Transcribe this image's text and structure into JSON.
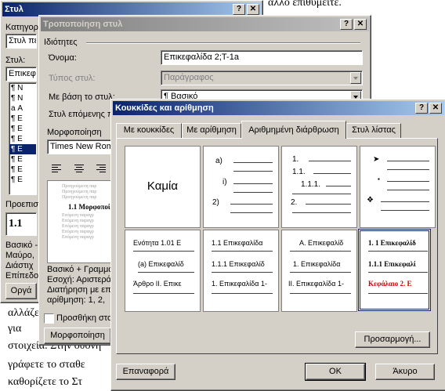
{
  "document": {
    "top_right_text": "άλλο επιθυμείτε.",
    "lines": [
      "αλλάζετε",
      "για",
      "στοιχεία. Στην οθόνη",
      "γράφετε το σταθε",
      "καθορίζετε το Στ"
    ]
  },
  "style_dialog": {
    "title": "Στυλ",
    "help": "?",
    "close": "✕",
    "category_label": "Κατηγορ",
    "category_value": "Στυλ πε",
    "styles_label": "Στυλ:",
    "styles_value": "Επικεφ",
    "style_items": [
      "¶ Ν",
      "¶ Ν",
      "a Α",
      "¶ Ε",
      "¶ Ε",
      "¶ Ε",
      "¶ Ε",
      "¶ Ε",
      "¶ Ε",
      "¶ Ε"
    ],
    "preview_label": "Προεπισ",
    "preview_sample": "1.1",
    "description_lines": [
      "Βασικό -",
      "Μαύρο,",
      "Διάστιχ",
      "Επίπεδο"
    ],
    "organizer_button": "Οργά"
  },
  "modify_dialog": {
    "title": "Τροποποίηση στυλ",
    "help": "?",
    "close": "✕",
    "group_label": "Ιδιότητες",
    "name_label": "Όνομα:",
    "name_value": "Επικεφαλίδα 2;T-1a",
    "style_type_label": "Τύπος στυλ:",
    "style_type_value": "Παράγραφος",
    "based_on_label": "Με βάση το στυλ:",
    "based_on_value": "¶ Βασικό",
    "next_style_label": "Στυλ επόμενης π",
    "formatting_label": "Μορφοποίηση",
    "font_value": "Times New Rom",
    "preview_heading": "1.1 Μορφοποί",
    "preview_dim": "Προηγούμενη παρ",
    "preview_next": "Επόμενη παραγρ",
    "description": [
      "Βασικό + Γραμμα",
      "Εσοχή: Αριστερά",
      "Διατήρηση με επο",
      "αρίθμηση: 1, 2,"
    ],
    "add_template_label": "Προσθήκη στο",
    "format_button": "Μορφοποίηση"
  },
  "bullets_dialog": {
    "title": "Κουκκίδες και αρίθμηση",
    "help": "?",
    "close": "✕",
    "tabs": [
      "Με κουκκίδες",
      "Με αρίθμηση",
      "Αριθμημένη διάρθρωση",
      "Στυλ λίστας"
    ],
    "selected_tab": 2,
    "none_label": "Καμία",
    "gallery_row1": {
      "c2": [
        "a)",
        "i)",
        "2)"
      ],
      "c3": [
        "1.",
        "1.1.",
        "1.1.1.",
        "2."
      ],
      "c4": [
        "➤",
        "▪",
        "❖"
      ]
    },
    "gallery_row2": {
      "c1": [
        "Ενότητα 1.01 Ε",
        "(a) Επικεφαλίδ",
        "Άρθρο II. Επικε"
      ],
      "c2": [
        "1.1 Επικεφαλίδα",
        "1.1.1 Επικεφαλίδ",
        "1. Επικεφαλίδα 1-"
      ],
      "c3": [
        "A. Επικεφαλίδ",
        "1. Επικεφαλίδα",
        "II. Επικεφαλίδα 1-"
      ],
      "c4": [
        "1. 1 Επικεφαλίδ",
        "1.1.1 Επικεφαλί",
        "Κεφάλαιο 2. Ε"
      ]
    },
    "customize_button": "Προσαρμογή...",
    "reset_button": "Επαναφορά",
    "ok_button": "OK",
    "cancel_button": "Άκυρο",
    "accent_color": "#cc0000"
  }
}
